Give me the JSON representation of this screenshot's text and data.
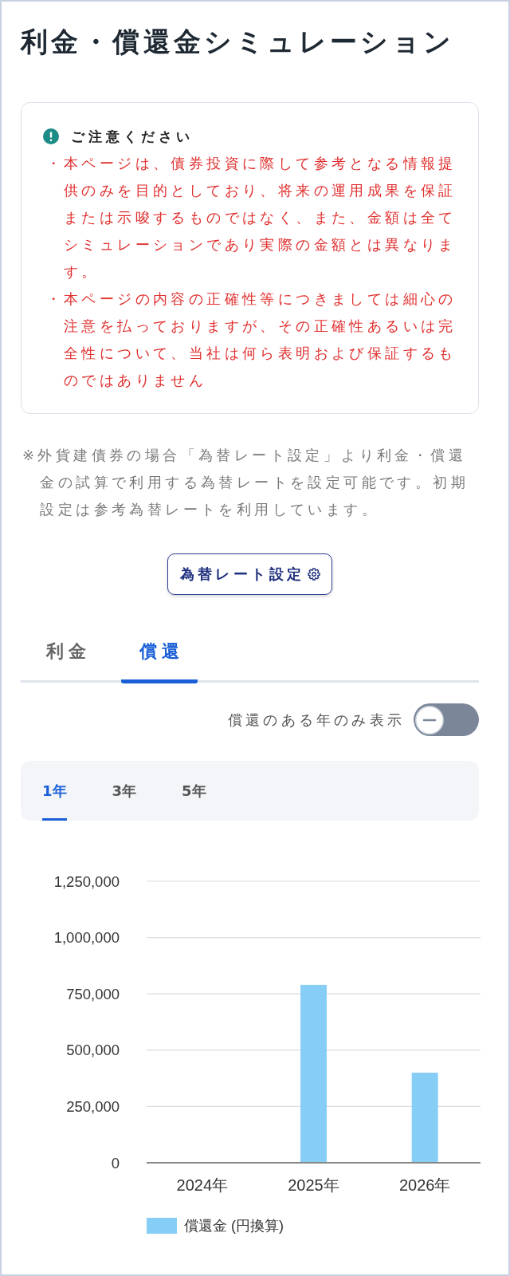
{
  "title": "利金・償還金シミュレーション",
  "notice": {
    "heading": "ご注意ください",
    "items": [
      "・本ページは、債券投資に際して参考となる情報提供のみを目的としており、将来の運用成果を保証または示唆するものではなく、また、金額は全てシミュレーションであり実際の金額とは異なります。",
      "・本ページの内容の正確性等につきましては細心の注意を払っておりますが、その正確性あるいは完全性について、当社は何ら表明および保証するものではありません"
    ]
  },
  "note": "※外貨建債券の場合「為替レート設定」より利金・償還金の試算で利用する為替レートを設定可能です。初期設定は参考為替レートを利用しています。",
  "rate_button": {
    "label": "為替レート設定"
  },
  "tabs": [
    {
      "label": "利金",
      "selected": false
    },
    {
      "label": "償還",
      "selected": true
    }
  ],
  "toggle": {
    "label": "償還のある年のみ表示",
    "on": false
  },
  "period_tabs": [
    {
      "label": "1年",
      "selected": true
    },
    {
      "label": "3年",
      "selected": false
    },
    {
      "label": "5年",
      "selected": false
    }
  ],
  "chart_data": {
    "type": "bar",
    "categories": [
      "2024年",
      "2025年",
      "2026年"
    ],
    "series": [
      {
        "name": "償還金 (円換算)",
        "color": "#87cef6",
        "values": [
          0,
          790000,
          400000
        ]
      }
    ],
    "ylim": [
      0,
      1250000
    ],
    "yticks": [
      {
        "value": 0,
        "label": "0"
      },
      {
        "value": 250000,
        "label": "250,000"
      },
      {
        "value": 500000,
        "label": "500,000"
      },
      {
        "value": 750000,
        "label": "750,000"
      },
      {
        "value": 1000000,
        "label": "1,000,000"
      },
      {
        "value": 1250000,
        "label": "1,250,000"
      }
    ],
    "grid": true
  }
}
